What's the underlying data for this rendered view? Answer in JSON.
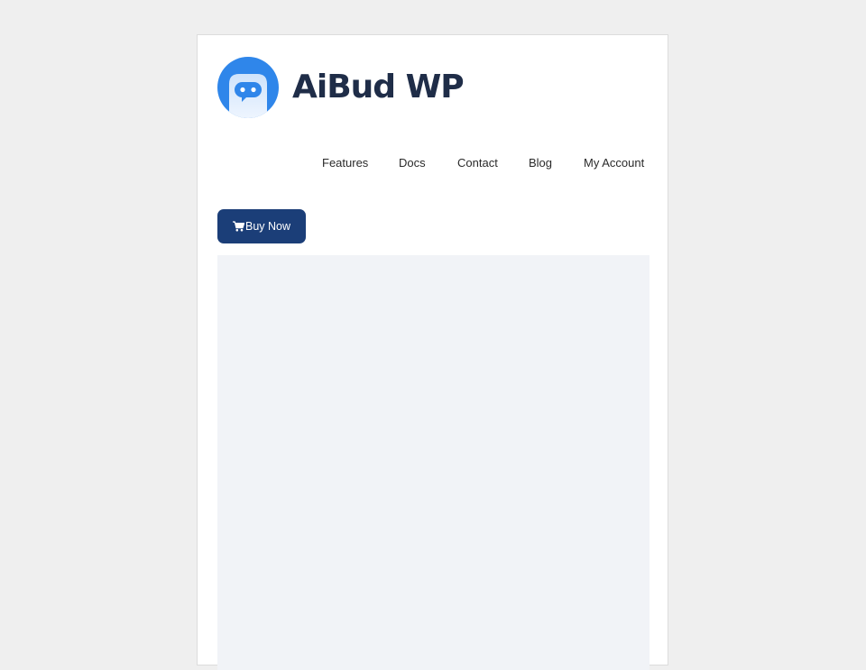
{
  "brand": {
    "name": "AiBud WP",
    "logo_icon": "robot-chat-icon",
    "logo_color": "#2f86ea",
    "text_color": "#1f2d48"
  },
  "nav": {
    "items": [
      {
        "label": "Features"
      },
      {
        "label": "Docs"
      },
      {
        "label": "Contact"
      },
      {
        "label": "Blog"
      },
      {
        "label": "My Account"
      }
    ]
  },
  "cta": {
    "label": "Buy Now",
    "icon": "cart-icon",
    "color": "#1b3e78"
  },
  "colors": {
    "page_bg": "#efefef",
    "card_bg": "#ffffff",
    "content_bg": "#f1f3f7"
  }
}
